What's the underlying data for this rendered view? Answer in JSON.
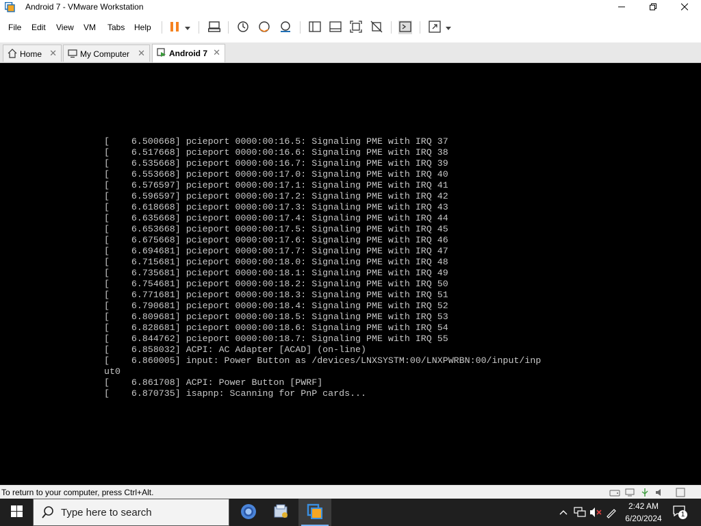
{
  "window": {
    "title": "Android 7 - VMware Workstation",
    "controls": {
      "minimize": "minimize-icon",
      "restore": "restore-icon",
      "close": "close-icon"
    }
  },
  "menu": {
    "items": [
      {
        "label": "File"
      },
      {
        "label": "Edit"
      },
      {
        "label": "View"
      },
      {
        "label": "VM"
      },
      {
        "label": "Tabs"
      },
      {
        "label": "Help"
      }
    ]
  },
  "toolbar": {
    "icons": [
      "pause-icon",
      "send-ctrl-alt-del-icon",
      "snapshot-icon",
      "revert-snapshot-icon",
      "snapshot-manager-icon",
      "show-library-icon",
      "thumbnail-bar-icon",
      "fit-guest-icon",
      "unity-icon",
      "console-view-icon",
      "fullscreen-icon"
    ]
  },
  "tabs": [
    {
      "label": "Home",
      "icon": "home-icon",
      "active": false
    },
    {
      "label": "My Computer",
      "icon": "computer-icon",
      "active": false
    },
    {
      "label": "Android 7",
      "icon": "vm-icon",
      "active": true
    }
  ],
  "console": {
    "lines": [
      "[    6.500668] pcieport 0000:00:16.5: Signaling PME with IRQ 37",
      "[    6.517668] pcieport 0000:00:16.6: Signaling PME with IRQ 38",
      "[    6.535668] pcieport 0000:00:16.7: Signaling PME with IRQ 39",
      "[    6.553668] pcieport 0000:00:17.0: Signaling PME with IRQ 40",
      "[    6.576597] pcieport 0000:00:17.1: Signaling PME with IRQ 41",
      "[    6.596597] pcieport 0000:00:17.2: Signaling PME with IRQ 42",
      "[    6.618668] pcieport 0000:00:17.3: Signaling PME with IRQ 43",
      "[    6.635668] pcieport 0000:00:17.4: Signaling PME with IRQ 44",
      "[    6.653668] pcieport 0000:00:17.5: Signaling PME with IRQ 45",
      "[    6.675668] pcieport 0000:00:17.6: Signaling PME with IRQ 46",
      "[    6.694681] pcieport 0000:00:17.7: Signaling PME with IRQ 47",
      "[    6.715681] pcieport 0000:00:18.0: Signaling PME with IRQ 48",
      "[    6.735681] pcieport 0000:00:18.1: Signaling PME with IRQ 49",
      "[    6.754681] pcieport 0000:00:18.2: Signaling PME with IRQ 50",
      "[    6.771681] pcieport 0000:00:18.3: Signaling PME with IRQ 51",
      "[    6.790681] pcieport 0000:00:18.4: Signaling PME with IRQ 52",
      "[    6.809681] pcieport 0000:00:18.5: Signaling PME with IRQ 53",
      "[    6.828681] pcieport 0000:00:18.6: Signaling PME with IRQ 54",
      "[    6.844762] pcieport 0000:00:18.7: Signaling PME with IRQ 55",
      "[    6.858032] ACPI: AC Adapter [ACAD] (on-line)",
      "[    6.860005] input: Power Button as /devices/LNXSYSTM:00/LNXPWRBN:00/input/inp",
      "ut0",
      "[    6.861708] ACPI: Power Button [PWRF]",
      "[    6.870735] isapnp: Scanning for PnP cards..."
    ]
  },
  "status": {
    "message": "To return to your computer, press Ctrl+Alt.",
    "icons": [
      "hard-disk-icon",
      "network-adapter-icon",
      "usb-icon",
      "sound-card-icon",
      "message-log-icon"
    ]
  },
  "taskbar": {
    "search_placeholder": "Type here to search",
    "apps": [
      "chrome-icon",
      "file-explorer-icon",
      "vmware-workstation-icon"
    ],
    "tray": [
      "show-hidden-icons-icon",
      "network-icon",
      "volume-muted-icon",
      "pen-workspace-icon"
    ],
    "time": "2:42 AM",
    "date": "6/20/2024",
    "notifications_count": "1"
  },
  "colors": {
    "console_bg": "#000000",
    "console_text": "#c8c8c8",
    "taskbar_bg": "#1f1f1f",
    "vmware_accent": "#f58220",
    "active_indicator": "#7ab6ff"
  }
}
